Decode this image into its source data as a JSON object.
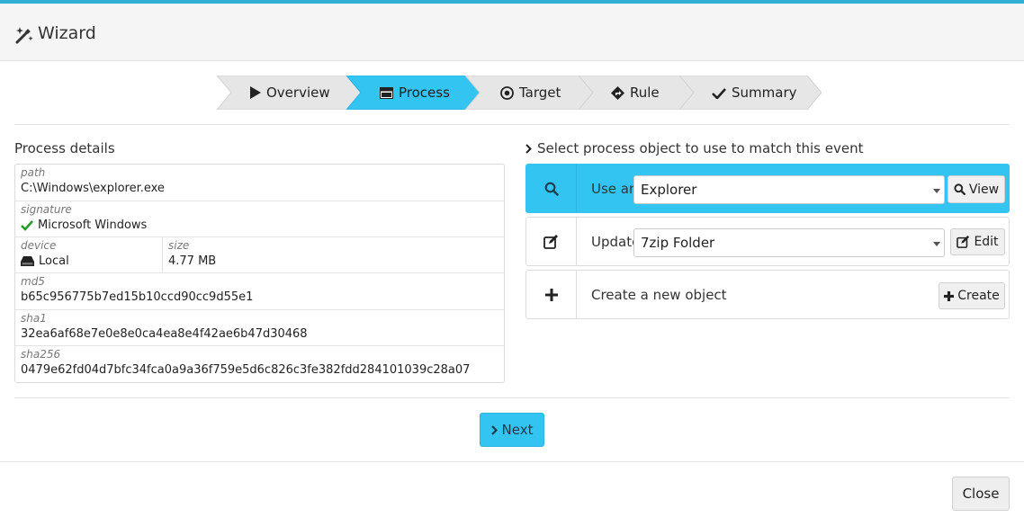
{
  "window": {
    "title": "Wizard"
  },
  "steps": [
    {
      "label": "Overview",
      "icon": "play-icon",
      "active": false
    },
    {
      "label": "Process",
      "icon": "window-icon",
      "active": true
    },
    {
      "label": "Target",
      "icon": "target-icon",
      "active": false
    },
    {
      "label": "Rule",
      "icon": "diamond-arrow-icon",
      "active": false
    },
    {
      "label": "Summary",
      "icon": "checkmark-icon",
      "active": false
    }
  ],
  "process_details": {
    "title": "Process details",
    "path": {
      "label": "path",
      "value": "C:\\Windows\\explorer.exe"
    },
    "signature": {
      "label": "signature",
      "value": "Microsoft Windows",
      "icon": "checkmark-icon",
      "color": "#2a9d2a"
    },
    "device": {
      "label": "device",
      "value": "Local",
      "icon": "drive-icon"
    },
    "size": {
      "label": "size",
      "value": "4.77 MB"
    },
    "md5": {
      "label": "md5",
      "value": "b65c956775b7ed15b10ccd90cc9d55e1"
    },
    "sha1": {
      "label": "sha1",
      "value": "32ea6af68e7e0e8e0ca4ea8e4f42ae6b47d30468"
    },
    "sha256": {
      "label": "sha256",
      "value": "0479e62fd04d7bfc34fca0a9a36f759e5d6c826c3fe382fdd284101039c28a07"
    }
  },
  "select_panel": {
    "title": "Select process object to use to match this event",
    "options": {
      "use": {
        "text": "Use an",
        "selected_value": "Explorer",
        "button": "View",
        "selected": true
      },
      "update": {
        "text": "Update",
        "selected_value": "7zip Folder",
        "button": "Edit"
      },
      "create": {
        "text": "Create a new object",
        "button": "Create"
      }
    }
  },
  "footer": {
    "next": "Next",
    "close": "Close"
  },
  "colors": {
    "accent": "#33c4f2",
    "check": "#2a9d2a"
  }
}
